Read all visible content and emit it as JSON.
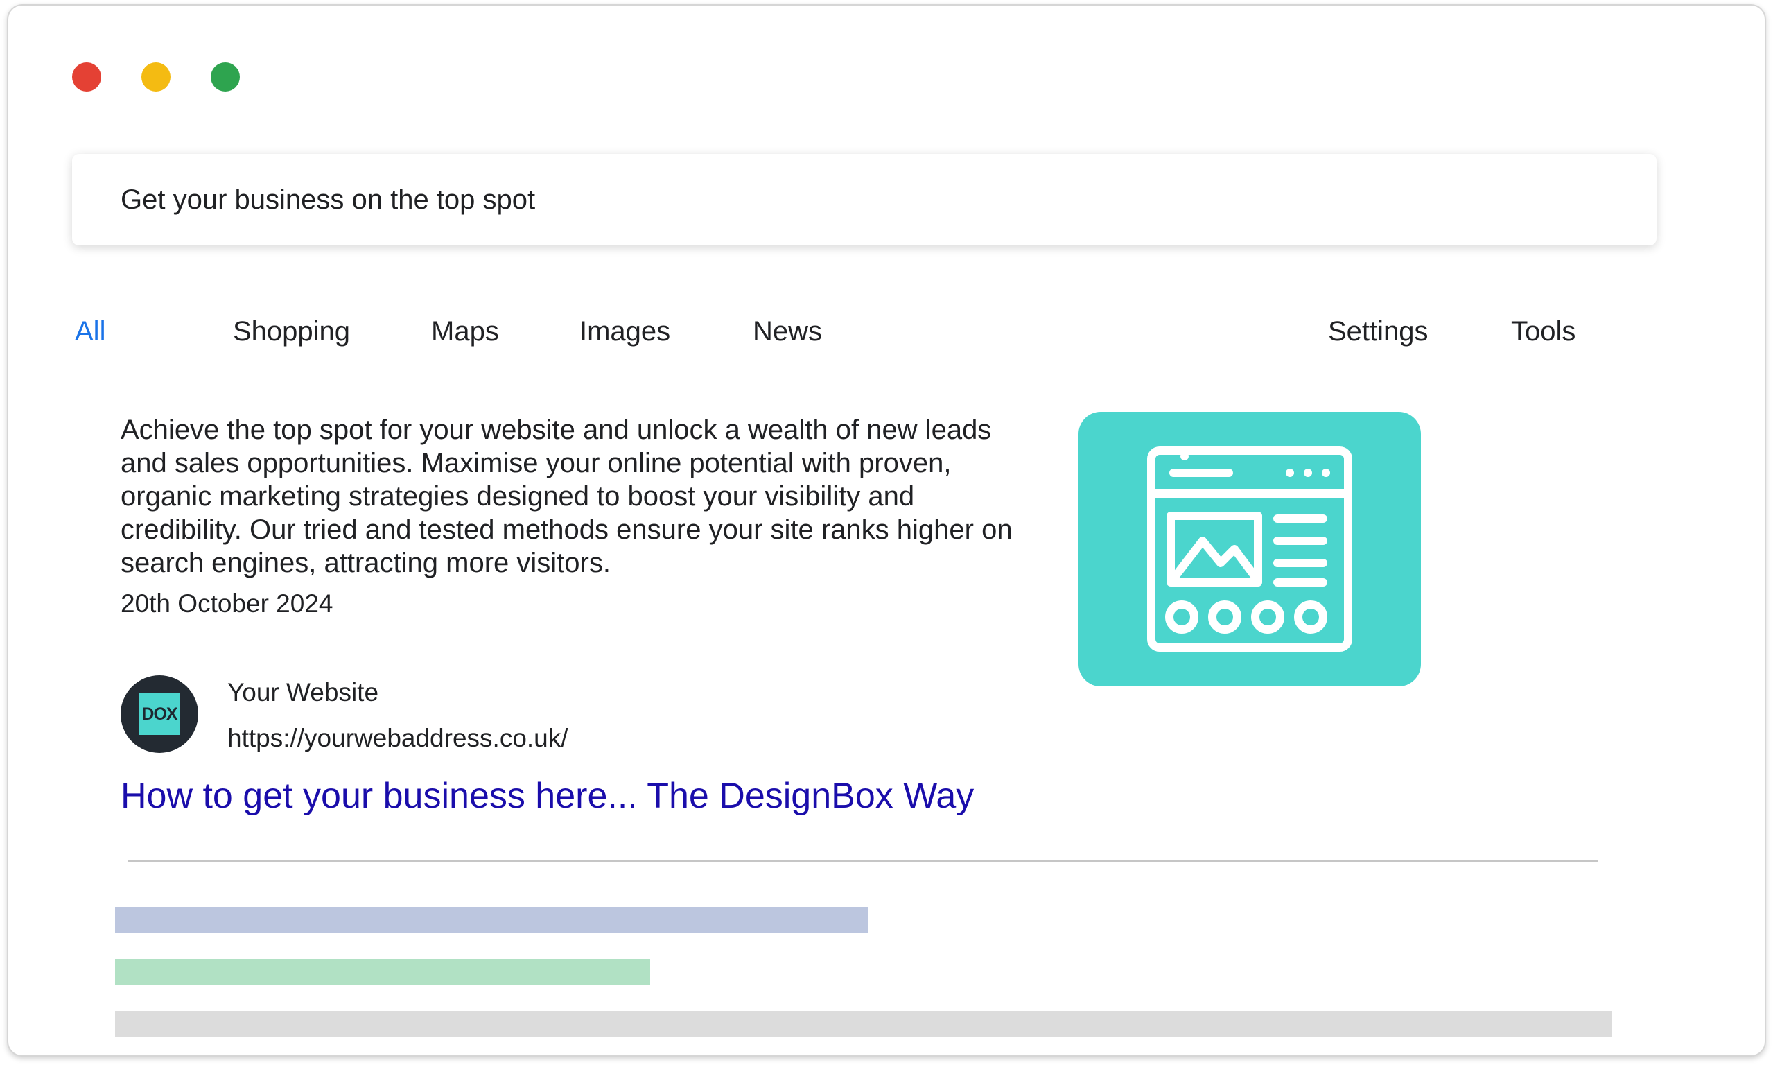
{
  "window": {
    "controls": {
      "close_color": "#e44134",
      "minimize_color": "#f4bb12",
      "maximize_color": "#2ea44f"
    }
  },
  "search": {
    "value": "Get your business on the top spot"
  },
  "tabs": [
    {
      "label": "All",
      "active": true
    },
    {
      "label": "Shopping",
      "active": false
    },
    {
      "label": "Maps",
      "active": false
    },
    {
      "label": "Images",
      "active": false
    },
    {
      "label": "News",
      "active": false
    }
  ],
  "tools": {
    "settings_label": "Settings",
    "tools_label": "Tools"
  },
  "result": {
    "description": "Achieve the top spot for your website and unlock a wealth of new leads and sales opportunities. Maximise your online potential with proven, organic marketing strategies designed to boost your visibility and credibility. Our tried and tested methods ensure your site ranks higher on search engines, attracting more visitors.",
    "date": "20th October 2024",
    "site_logo_text": "DOX",
    "site_name": "Your Website",
    "site_url": "https://yourwebaddress.co.uk/",
    "title": "How to get your business here... The DesignBox Way",
    "thumbnail_icon": "webpage-layout-icon",
    "thumbnail_color": "#4bd5cd"
  },
  "placeholder_bars": [
    {
      "color": "#bcc6df"
    },
    {
      "color": "#b1e1c4"
    },
    {
      "color": "#dcdcdc"
    }
  ],
  "colors": {
    "active_tab": "#1a73e8",
    "link": "#1a0dab"
  }
}
